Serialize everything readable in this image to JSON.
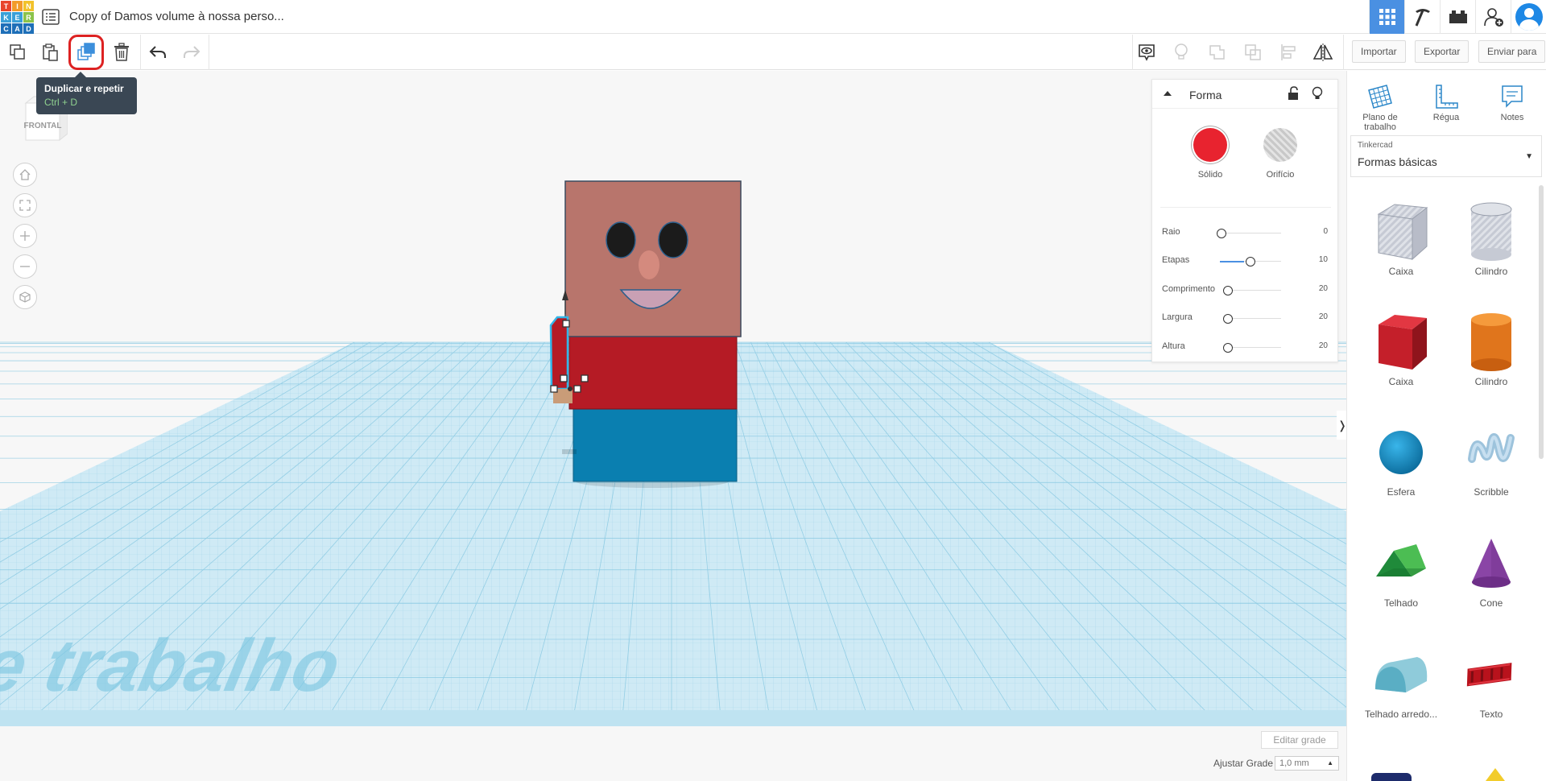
{
  "header": {
    "logo_letters": [
      "T",
      "I",
      "N",
      "K",
      "E",
      "R",
      "C",
      "A",
      "D"
    ],
    "project_title": "Copy of Damos volume à nossa perso..."
  },
  "toolbar": {
    "import_label": "Importar",
    "export_label": "Exportar",
    "send_label": "Enviar para"
  },
  "tooltip": {
    "title": "Duplicar e repetir",
    "shortcut": "Ctrl + D"
  },
  "viewport": {
    "viewcube_label": "FRONTAL",
    "workplane_watermark": "o de trabalho",
    "edit_grid_label": "Editar grade",
    "snap_grid_label": "Ajustar Grade",
    "snap_grid_value": "1,0 mm"
  },
  "inspector": {
    "title": "Forma",
    "solid_label": "Sólido",
    "hole_label": "Orifício",
    "solid_color": "#e8232f",
    "params": [
      {
        "label": "Raio",
        "value": "0",
        "level": 0.0
      },
      {
        "label": "Etapas",
        "value": "10",
        "level": 0.4
      },
      {
        "label": "Comprimento",
        "value": "20",
        "level": 0.0
      },
      {
        "label": "Largura",
        "value": "20",
        "level": 0.0
      },
      {
        "label": "Altura",
        "value": "20",
        "level": 0.0
      }
    ]
  },
  "sidebar": {
    "tools": [
      {
        "label": "Plano de trabalho",
        "icon": "workplane-icon"
      },
      {
        "label": "Régua",
        "icon": "ruler-icon"
      },
      {
        "label": "Notes",
        "icon": "notes-icon"
      }
    ],
    "library_caption": "Tinkercad",
    "library_value": "Formas básicas",
    "shapes": [
      {
        "label": "Caixa",
        "icon": "box-hole-icon"
      },
      {
        "label": "Cilindro",
        "icon": "cylinder-hole-icon"
      },
      {
        "label": "Caixa",
        "icon": "box-icon"
      },
      {
        "label": "Cilindro",
        "icon": "cylinder-icon"
      },
      {
        "label": "Esfera",
        "icon": "sphere-icon"
      },
      {
        "label": "Scribble",
        "icon": "scribble-icon"
      },
      {
        "label": "Telhado",
        "icon": "roof-icon"
      },
      {
        "label": "Cone",
        "icon": "cone-icon"
      },
      {
        "label": "Telhado arredo...",
        "icon": "round-roof-icon"
      },
      {
        "label": "Texto",
        "icon": "text-icon"
      }
    ]
  },
  "colors": {
    "accent": "#4a90e2",
    "grid": "#a9dbee",
    "model_face": "#b8756c",
    "model_shirt": "#b51b25",
    "model_pants": "#0a7fb0"
  }
}
